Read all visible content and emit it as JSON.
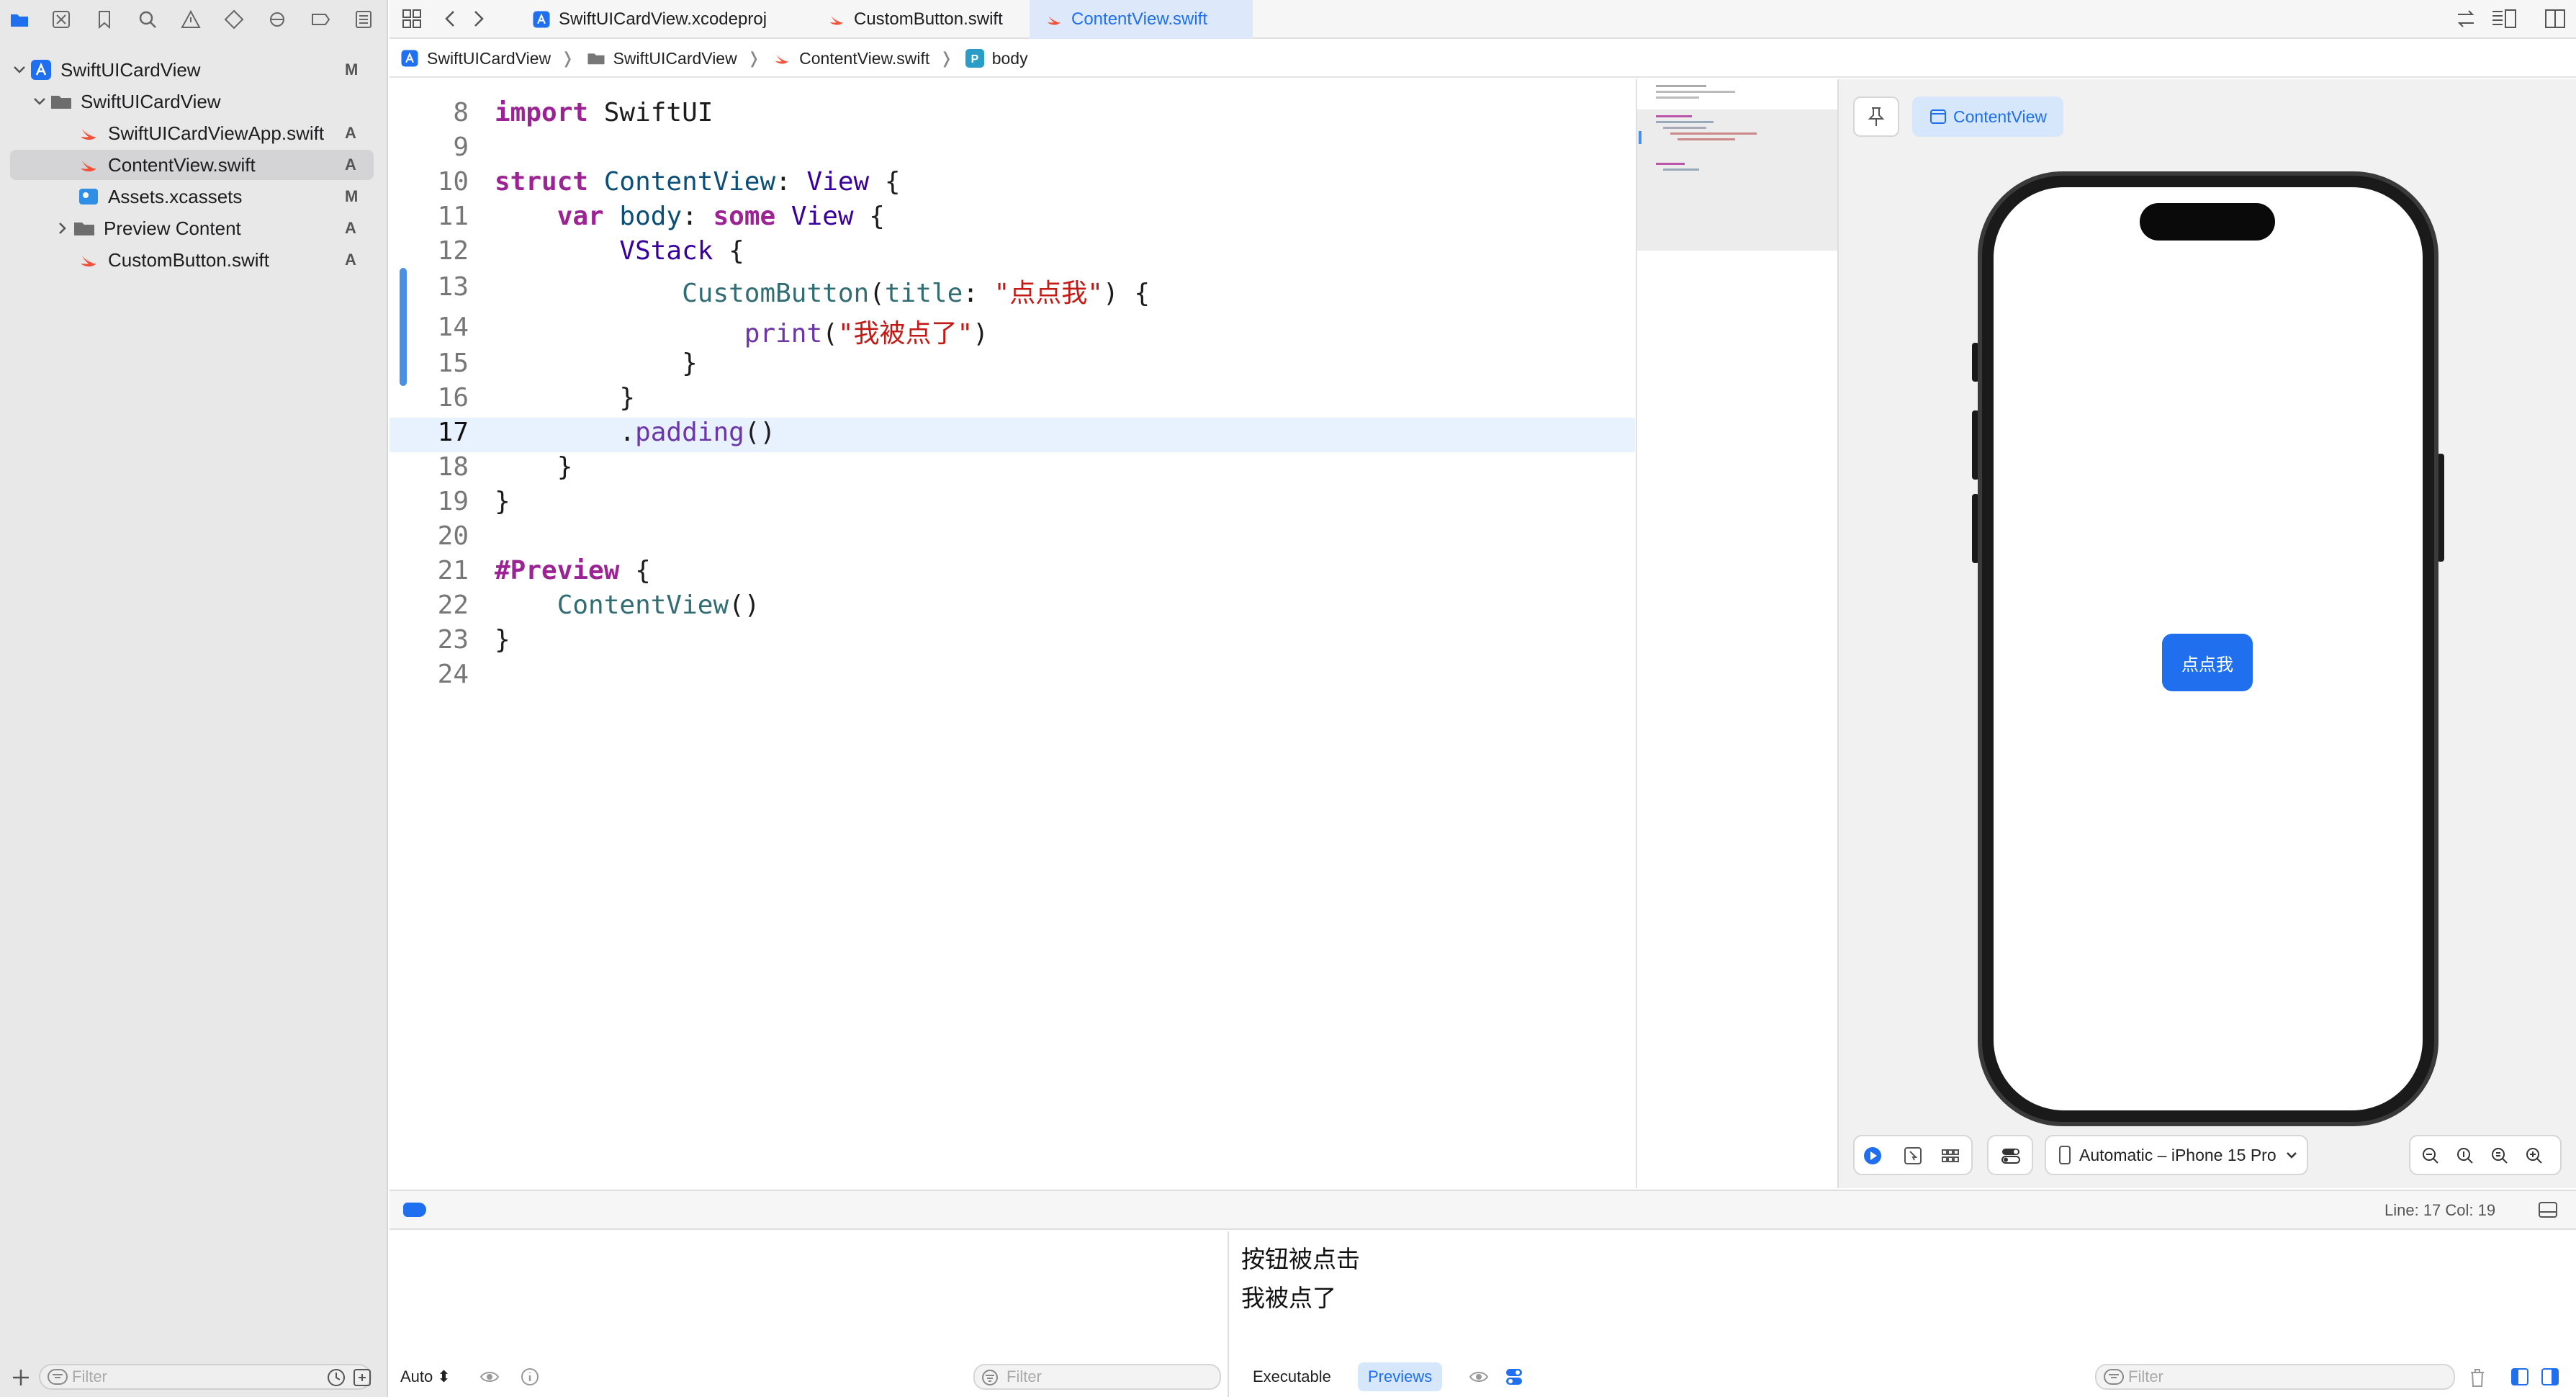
{
  "navigator": {
    "items": [
      {
        "label": "SwiftUICardView",
        "status": "M"
      },
      {
        "label": "SwiftUICardView",
        "status": ""
      },
      {
        "label": "SwiftUICardViewApp.swift",
        "status": "A"
      },
      {
        "label": "ContentView.swift",
        "status": "A"
      },
      {
        "label": "Assets.xcassets",
        "status": "M"
      },
      {
        "label": "Preview Content",
        "status": "A"
      },
      {
        "label": "CustomButton.swift",
        "status": "A"
      }
    ],
    "filter_placeholder": "Filter"
  },
  "tabs": [
    {
      "label": "SwiftUICardView.xcodeproj"
    },
    {
      "label": "CustomButton.swift"
    },
    {
      "label": "ContentView.swift"
    }
  ],
  "breadcrumb": [
    "SwiftUICardView",
    "SwiftUICardView",
    "ContentView.swift",
    "body"
  ],
  "editor": {
    "line_numbers": [
      "8",
      "9",
      "10",
      "11",
      "12",
      "13",
      "14",
      "15",
      "16",
      "17",
      "18",
      "19",
      "20",
      "21",
      "22",
      "23",
      "24"
    ],
    "current_line": "17"
  },
  "preview": {
    "chip_label": "ContentView",
    "app_button_label": "点点我",
    "device_label": "Automatic – iPhone 15 Pro"
  },
  "status": {
    "line_col": "Line: 17  Col: 19"
  },
  "debug": {
    "auto_label": "Auto",
    "filter_placeholder": "Filter",
    "console_lines": [
      "按钮被点击",
      "我被点了"
    ],
    "executable_label": "Executable",
    "previews_label": "Previews"
  },
  "colors": {
    "accent": "#1f6fef",
    "selection": "#d4d4d6",
    "current_line": "#e8f2ff"
  }
}
